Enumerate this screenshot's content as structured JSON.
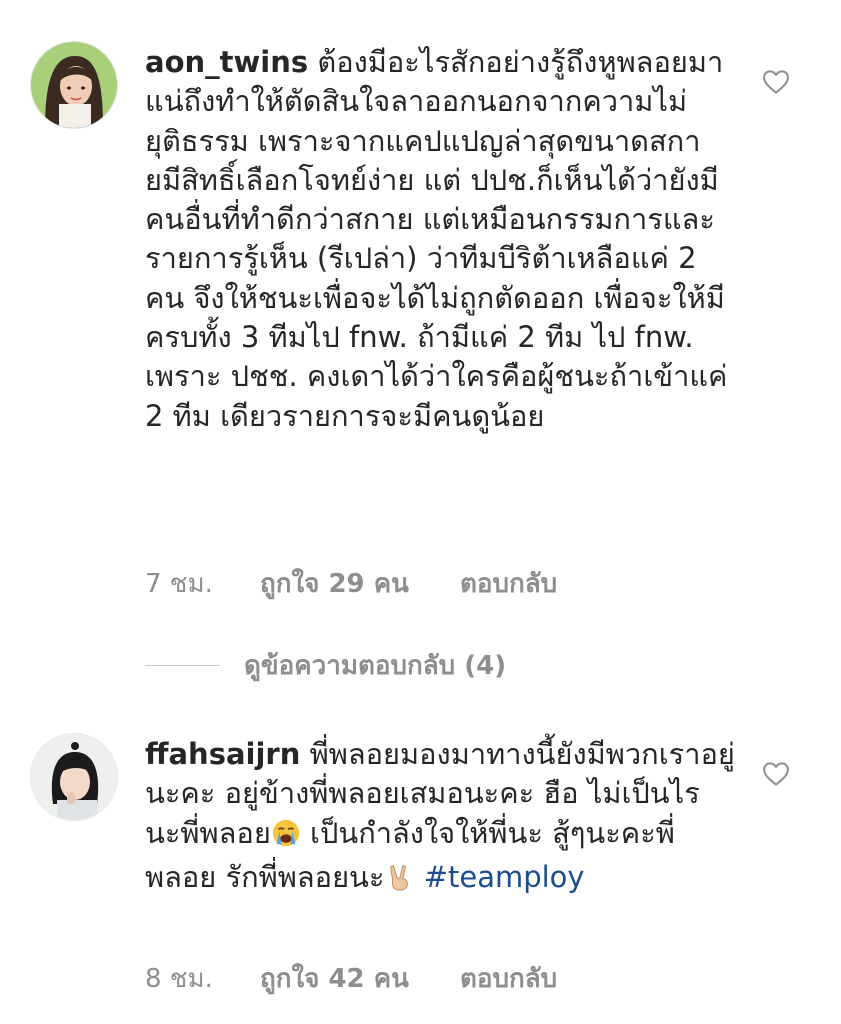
{
  "comments": [
    {
      "username": "aon_twins",
      "text": "ต้องมีอะไรสักอย่างรู้ถึงหูพลอยมาแน่ถึงทำให้ตัดสินใจลาออกนอกจากความไม่ยุติธรรม เพราะจากแคปแปญล่าสุดขนาดสกายมีสิทธิ์เลือกโจทย์ง่าย แต่ ปปช.ก็เห็นได้ว่ายังมีคนอื่นที่ทำดีกว่าสกาย แต่เหมือนกรรมการและรายการรู้เห็น (รีเปล่า) ว่าทีมบีริต้าเหลือแค่ 2 คน จึงให้ชนะเพื่อจะได้ไม่ถูกตัดออก เพื่อจะให้มีครบทั้ง 3 ทีมไป fnw. ถ้ามีแค่ 2 ทีม ไป fnw. เพราะ ปชช. คงเดาได้ว่าใครคือผู้ชนะถ้าเข้าแค่ 2 ทีม เดียวรายการจะมีคนดูน้อย",
      "time": "7 ชม.",
      "likes": "ถูกใจ 29 คน",
      "reply": "ตอบกลับ",
      "like_icon": "heart-outline-icon"
    },
    {
      "username": "ffahsaijrn",
      "text_part1": "พี่พลอยมองมาทางนี้ยังมีพวกเราอยู่นะคะ อยู่ข้างพี่พลอยเสมอนะคะ ฮือ ไม่เป็นไรนะพี่พลอย",
      "text_part2": " เป็นกำลังใจให้พี่นะ สู้ๆนะคะพี่พลอย รักพี่พลอยนะ",
      "hashtag": "#teamploy",
      "time": "8 ชม.",
      "likes": "ถูกใจ 42 คน",
      "reply": "ตอบกลับ",
      "emojis": [
        "loudly-crying-face",
        "victory-hand"
      ],
      "like_icon": "heart-outline-icon"
    }
  ],
  "view_replies": "ดูข้อความตอบกลับ (4)",
  "colors": {
    "text": "#262626",
    "secondary": "#8e8e8e",
    "hashtag": "#1d4d8c",
    "divider": "#c7c7c7"
  }
}
